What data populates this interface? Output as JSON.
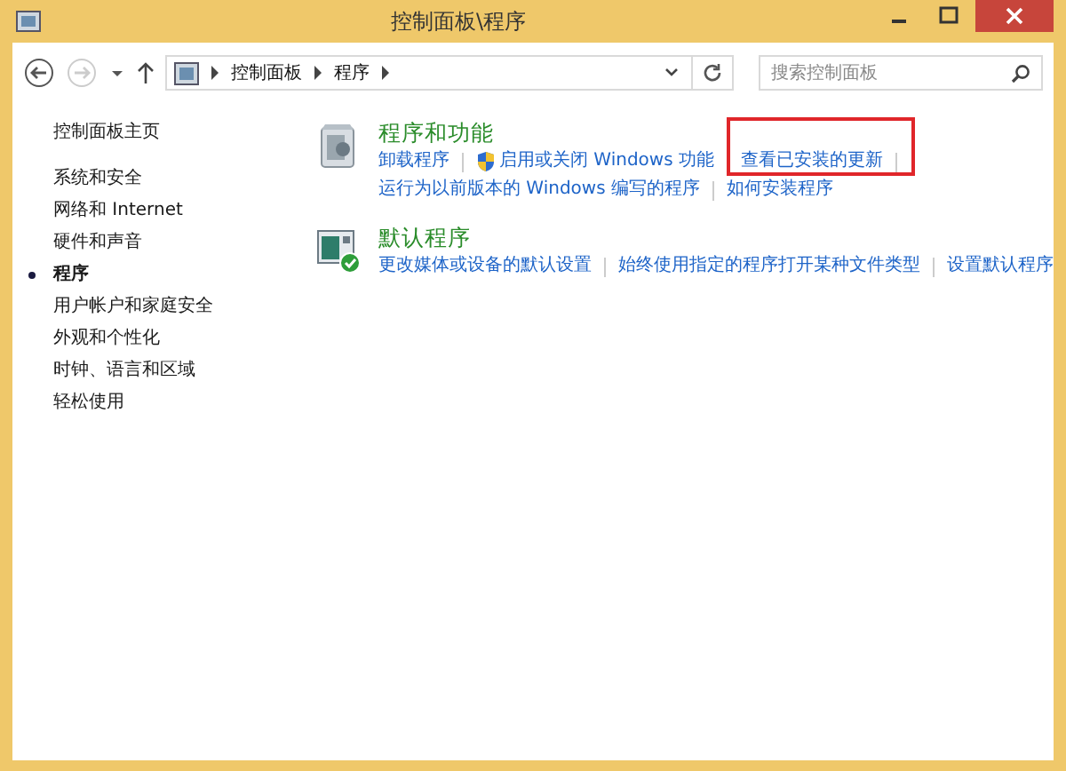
{
  "window": {
    "title": "控制面板\\程序"
  },
  "address_bar": {
    "crumbs": [
      "控制面板",
      "程序"
    ]
  },
  "search": {
    "placeholder": "搜索控制面板"
  },
  "sidebar": {
    "home": "控制面板主页",
    "items": [
      {
        "label": "系统和安全",
        "selected": false
      },
      {
        "label": "网络和 Internet",
        "selected": false
      },
      {
        "label": "硬件和声音",
        "selected": false
      },
      {
        "label": "程序",
        "selected": true
      },
      {
        "label": "用户帐户和家庭安全",
        "selected": false
      },
      {
        "label": "外观和个性化",
        "selected": false
      },
      {
        "label": "时钟、语言和区域",
        "selected": false
      },
      {
        "label": "轻松使用",
        "selected": false
      }
    ]
  },
  "sections": [
    {
      "title": "程序和功能",
      "kind": "programs",
      "lines": [
        [
          {
            "label": "卸载程序",
            "kind": "plain",
            "highlighted": false
          },
          {
            "label": "启用或关闭 Windows 功能",
            "kind": "shield",
            "highlighted": false
          },
          {
            "label": "查看已安装的更新",
            "kind": "plain",
            "highlighted": true
          }
        ],
        [
          {
            "label": "运行为以前版本的 Windows 编写的程序",
            "kind": "plain",
            "highlighted": false
          },
          {
            "label": "如何安装程序",
            "kind": "plain",
            "highlighted": false
          }
        ]
      ]
    },
    {
      "title": "默认程序",
      "kind": "defaults",
      "lines": [
        [
          {
            "label": "更改媒体或设备的默认设置",
            "kind": "plain",
            "highlighted": false
          },
          {
            "label": "始终使用指定的程序打开某种文件类型",
            "kind": "plain",
            "highlighted": false
          },
          {
            "label": "设置默认程序",
            "kind": "plain",
            "highlighted": false
          }
        ]
      ]
    }
  ]
}
